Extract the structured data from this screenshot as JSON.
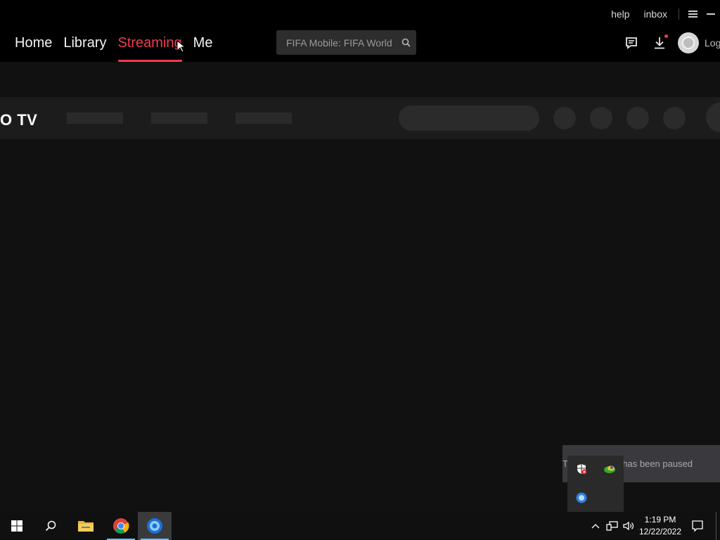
{
  "window": {
    "help_label": "help",
    "inbox_label": "inbox"
  },
  "nav": {
    "tabs": [
      {
        "label": "Home",
        "active": false
      },
      {
        "label": "Library",
        "active": false
      },
      {
        "label": "Streaming",
        "active": true
      },
      {
        "label": "Me",
        "active": false
      }
    ]
  },
  "search": {
    "value": "FIFA Mobile: FIFA World"
  },
  "account": {
    "login_label": "Log"
  },
  "content": {
    "brand": "O TV"
  },
  "toast": {
    "message": "The download has been paused"
  },
  "taskbar": {
    "time": "1:19 PM",
    "date": "12/22/2022"
  },
  "colors": {
    "accent": "#ef3b4f",
    "background": "#111111",
    "titlebar": "#000000"
  }
}
